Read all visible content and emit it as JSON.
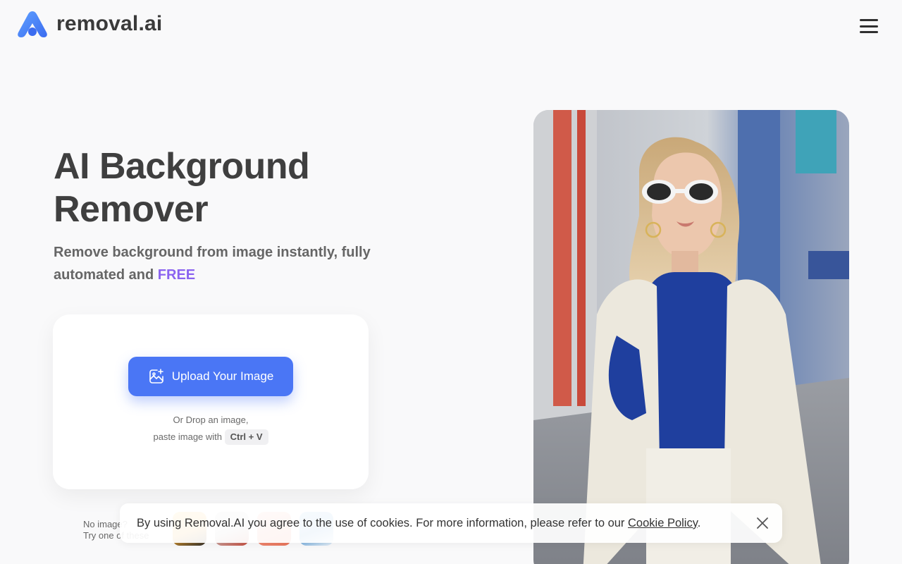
{
  "header": {
    "brand": "removal.ai",
    "logo_icon": "removal-ai-logo-icon",
    "menu_icon": "hamburger-menu-icon"
  },
  "hero": {
    "title": "AI Background Remover",
    "subtitle_part1": "Remove background from image instantly, fully automated and ",
    "subtitle_highlight": "FREE"
  },
  "upload": {
    "button_label": "Upload Your Image",
    "button_icon": "image-plus-icon",
    "hint_line1": "Or Drop an image,",
    "hint_line2": "paste image with",
    "shortcut": "Ctrl + V"
  },
  "samples": {
    "label_line1": "No image?",
    "label_line2": "Try one of these",
    "items": [
      "sample-1",
      "sample-2",
      "sample-3",
      "sample-4"
    ]
  },
  "cookie_bar": {
    "text": "By using Removal.AI you agree to the use of cookies. For more information, please refer to our ",
    "link": "Cookie Policy",
    "suffix": ".",
    "close_icon": "close-icon"
  },
  "colors": {
    "accent": "#4a76f5",
    "free": "#8a63f0",
    "text": "#3f3f3f"
  }
}
